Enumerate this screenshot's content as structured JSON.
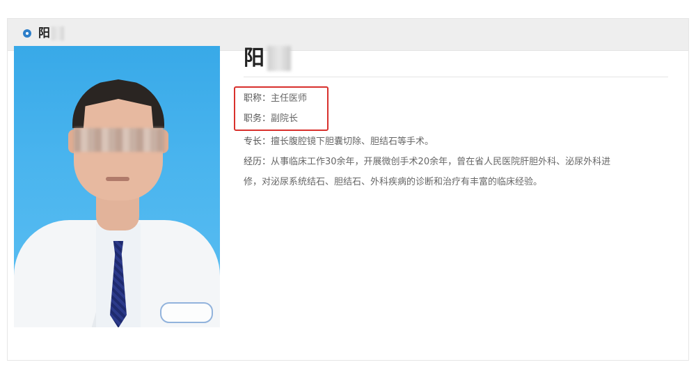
{
  "header": {
    "name": "阳"
  },
  "doctor": {
    "name": "阳",
    "title_label": "职称：",
    "title_value": "主任医师",
    "position_label": "职务：",
    "position_value": "副院长",
    "specialty_label": "专长：",
    "specialty_value": "擅长腹腔镜下胆囊切除、胆结石等手术。",
    "experience_label": "经历：",
    "experience_line1": "从事临床工作30余年，开展微创手术20余年，曾在省人民医院肝胆外科、泌尿外科进",
    "experience_line2": "修，对泌尿系统结石、胆结石、外科疾病的诊断和治疗有丰富的临床经验。"
  },
  "colors": {
    "accent": "#2e7fc9",
    "highlight_border": "#d8302c",
    "header_bg": "#eeeeee"
  }
}
